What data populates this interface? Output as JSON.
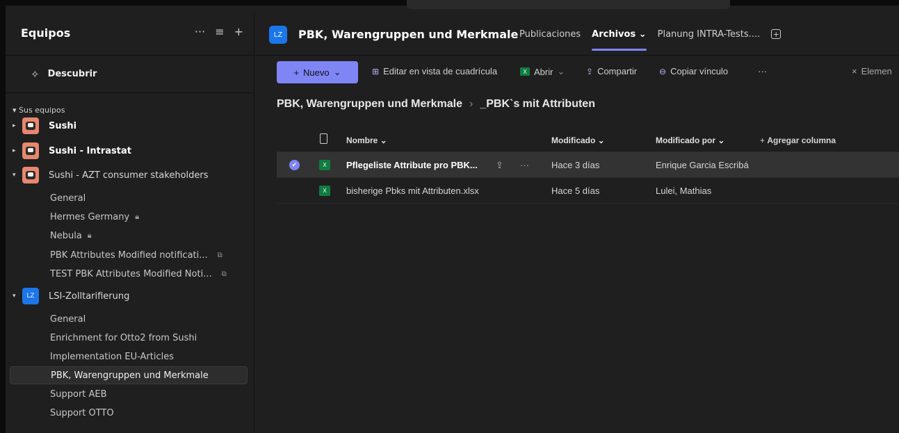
{
  "sidebar": {
    "title": "Equipos",
    "actions": {
      "more": "···",
      "filter": "≡",
      "add": "+"
    },
    "discover_label": "Descubrir",
    "section_label": "Sus equipos",
    "teams": [
      {
        "name": "Sushi",
        "avatar": "sushi-avatar"
      },
      {
        "name": "Sushi - Intrastat",
        "avatar": "sushi-avatar"
      },
      {
        "name": "Sushi - AZT consumer stakeholders",
        "avatar": "sushi-avatar"
      },
      {
        "name": "LSI-Zolltarifierung",
        "avatar": "LZ"
      }
    ],
    "channels_sushi_azt": [
      "General",
      "Hermes Germany",
      "Nebula",
      "PBK Attributes Modified notificati...",
      "TEST PBK Attributes Modified Noti..."
    ],
    "channels_lsi": [
      "General",
      "Enrichment for Otto2 from Sushi",
      "Implementation EU-Articles",
      "PBK, Warengruppen und Merkmale",
      "Support AEB",
      "Support OTTO"
    ]
  },
  "header": {
    "avatar_text": "LZ",
    "title": "PBK, Warengruppen und Merkmale",
    "tabs": [
      "Publicaciones",
      "Archivos",
      "Planung INTRA-Tests...."
    ],
    "active_tab": "Archivos"
  },
  "toolbar": {
    "new_label": "Nuevo",
    "grid_label": "Editar en vista de cuadrícula",
    "open_label": "Abrir",
    "share_label": "Compartir",
    "copy_link_label": "Copiar vínculo",
    "more": "···",
    "close_selection": "Elemen"
  },
  "breadcrumb": {
    "root": "PBK, Warengruppen und Merkmale",
    "current": "_PBK`s mit Attributen"
  },
  "table": {
    "headers": {
      "name": "Nombre",
      "modified": "Modificado",
      "modified_by": "Modificado por",
      "add_column": "Agregar columna"
    },
    "rows": [
      {
        "name": "Pflegeliste Attribute pro PBK...",
        "modified": "Hace 3 días",
        "modified_by": "Enrique Garcia Escribá",
        "selected": true
      },
      {
        "name": "bisherige Pbks mit Attributen.xlsx",
        "modified": "Hace 5 días",
        "modified_by": "Lulei, Mathias",
        "selected": false
      }
    ]
  },
  "colors": {
    "accent": "#7f85f5",
    "excel": "#107c41",
    "lz_avatar": "#1b76e8",
    "sushi_avatar": "#e8876f"
  }
}
